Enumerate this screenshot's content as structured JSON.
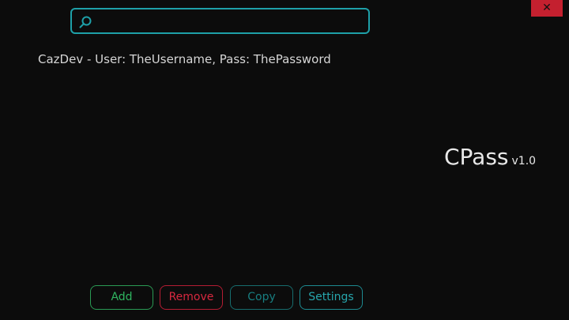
{
  "window": {
    "close_label": "✕"
  },
  "search": {
    "value": "",
    "placeholder": ""
  },
  "entries": [
    {
      "label": "CazDev - User: TheUsername, Pass: ThePassword"
    }
  ],
  "brand": {
    "name": "CPass",
    "version": "v1.0"
  },
  "actions": {
    "add_label": "Add",
    "remove_label": "Remove",
    "copy_label": "Copy",
    "settings_label": "Settings"
  },
  "colors": {
    "background": "#0c0c0c",
    "accent_teal": "#1ea0a8",
    "add_green": "#2fb560",
    "remove_red": "#d8283f",
    "close_red": "#c4202f"
  }
}
